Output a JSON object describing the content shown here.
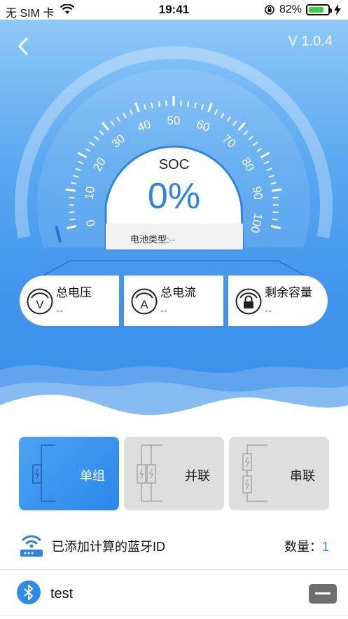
{
  "status_bar": {
    "carrier": "无 SIM 卡",
    "time": "19:41",
    "battery_pct_label": "82%",
    "battery_level": 0.82
  },
  "header": {
    "version": "V 1.0.4"
  },
  "gauge": {
    "ticks": [
      "0",
      "10",
      "20",
      "30",
      "40",
      "50",
      "60",
      "70",
      "80",
      "90",
      "100"
    ],
    "soc_label": "SOC",
    "soc_value": "0%",
    "soc_level": 0,
    "battery_type_label": "电池类型:",
    "battery_type_value": "--"
  },
  "metrics": [
    {
      "label": "总电压",
      "value": "--",
      "icon": "voltage-icon"
    },
    {
      "label": "总电流",
      "value": "--",
      "icon": "current-icon"
    },
    {
      "label": "剩余容量",
      "value": "--",
      "icon": "capacity-lock-icon"
    }
  ],
  "modes": [
    {
      "label": "单组",
      "selected": true
    },
    {
      "label": "并联",
      "selected": false
    },
    {
      "label": "串联",
      "selected": false
    }
  ],
  "bluetooth": {
    "title": "已添加计算的蓝牙ID",
    "count_label": "数量：",
    "count": "1"
  },
  "devices": [
    {
      "name": "test"
    }
  ],
  "colors": {
    "accent": "#2f83e6",
    "hero_top": "#8ec8f8",
    "hero_bottom": "#3a8fe8",
    "mode_inactive": "#dedede"
  }
}
